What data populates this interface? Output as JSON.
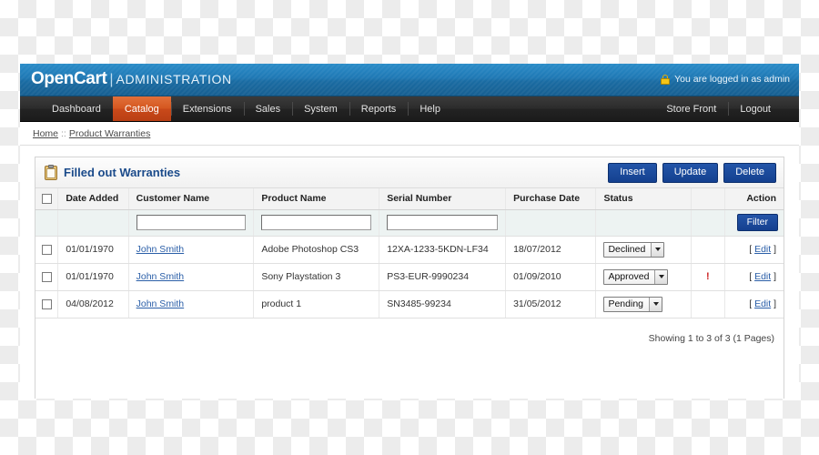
{
  "header": {
    "brand_name": "OpenCart",
    "brand_separator": "|",
    "brand_section": "ADMINISTRATION",
    "login_status": "You are logged in as admin",
    "lock_icon": "lock-icon"
  },
  "menu": {
    "left": [
      {
        "label": "Dashboard",
        "active": false
      },
      {
        "label": "Catalog",
        "active": true
      },
      {
        "label": "Extensions",
        "active": false
      },
      {
        "label": "Sales",
        "active": false
      },
      {
        "label": "System",
        "active": false
      },
      {
        "label": "Reports",
        "active": false
      },
      {
        "label": "Help",
        "active": false
      }
    ],
    "right": [
      {
        "label": "Store Front"
      },
      {
        "label": "Logout"
      }
    ]
  },
  "breadcrumb": {
    "home": "Home",
    "separator": "::",
    "current": "Product Warranties"
  },
  "panel": {
    "title": "Filled out Warranties",
    "title_icon": "clipboard-icon",
    "buttons": [
      {
        "label": "Insert",
        "name": "insert-button"
      },
      {
        "label": "Update",
        "name": "update-button"
      },
      {
        "label": "Delete",
        "name": "delete-button"
      }
    ]
  },
  "table": {
    "columns": [
      "Date Added",
      "Customer Name",
      "Product Name",
      "Serial Number",
      "Purchase Date",
      "Status",
      "Action"
    ],
    "filters": {
      "customer_name": "",
      "customer_name_placeholder": "",
      "product_name": "",
      "product_name_placeholder": "",
      "serial_number": "",
      "serial_number_placeholder": "",
      "filter_button": "Filter"
    },
    "rows": [
      {
        "date_added": "01/01/1970",
        "customer_name": "John Smith",
        "product_name": "Adobe Photoshop CS3",
        "serial_number": "12XA-1233-5KDN-LF34",
        "purchase_date": "18/07/2012",
        "status": "Declined",
        "flag": "",
        "action": "Edit"
      },
      {
        "date_added": "01/01/1970",
        "customer_name": "John Smith",
        "product_name": "Sony Playstation 3",
        "serial_number": "PS3-EUR-9990234",
        "purchase_date": "01/09/2010",
        "status": "Approved",
        "flag": "!",
        "action": "Edit"
      },
      {
        "date_added": "04/08/2012",
        "customer_name": "John Smith",
        "product_name": "product 1",
        "serial_number": "SN3485-99234",
        "purchase_date": "31/05/2012",
        "status": "Pending",
        "flag": "",
        "action": "Edit"
      }
    ],
    "footer": "Showing 1 to 3 of 3 (1 Pages)"
  },
  "colors": {
    "header_blue": "#1f78b4",
    "menu_dark": "#2b2b2b",
    "active_orange": "#d4561f",
    "button_blue": "#14408f",
    "link_blue": "#2b5fa8",
    "title_blue": "#1a4a8a",
    "flag_red": "#cc2222"
  }
}
